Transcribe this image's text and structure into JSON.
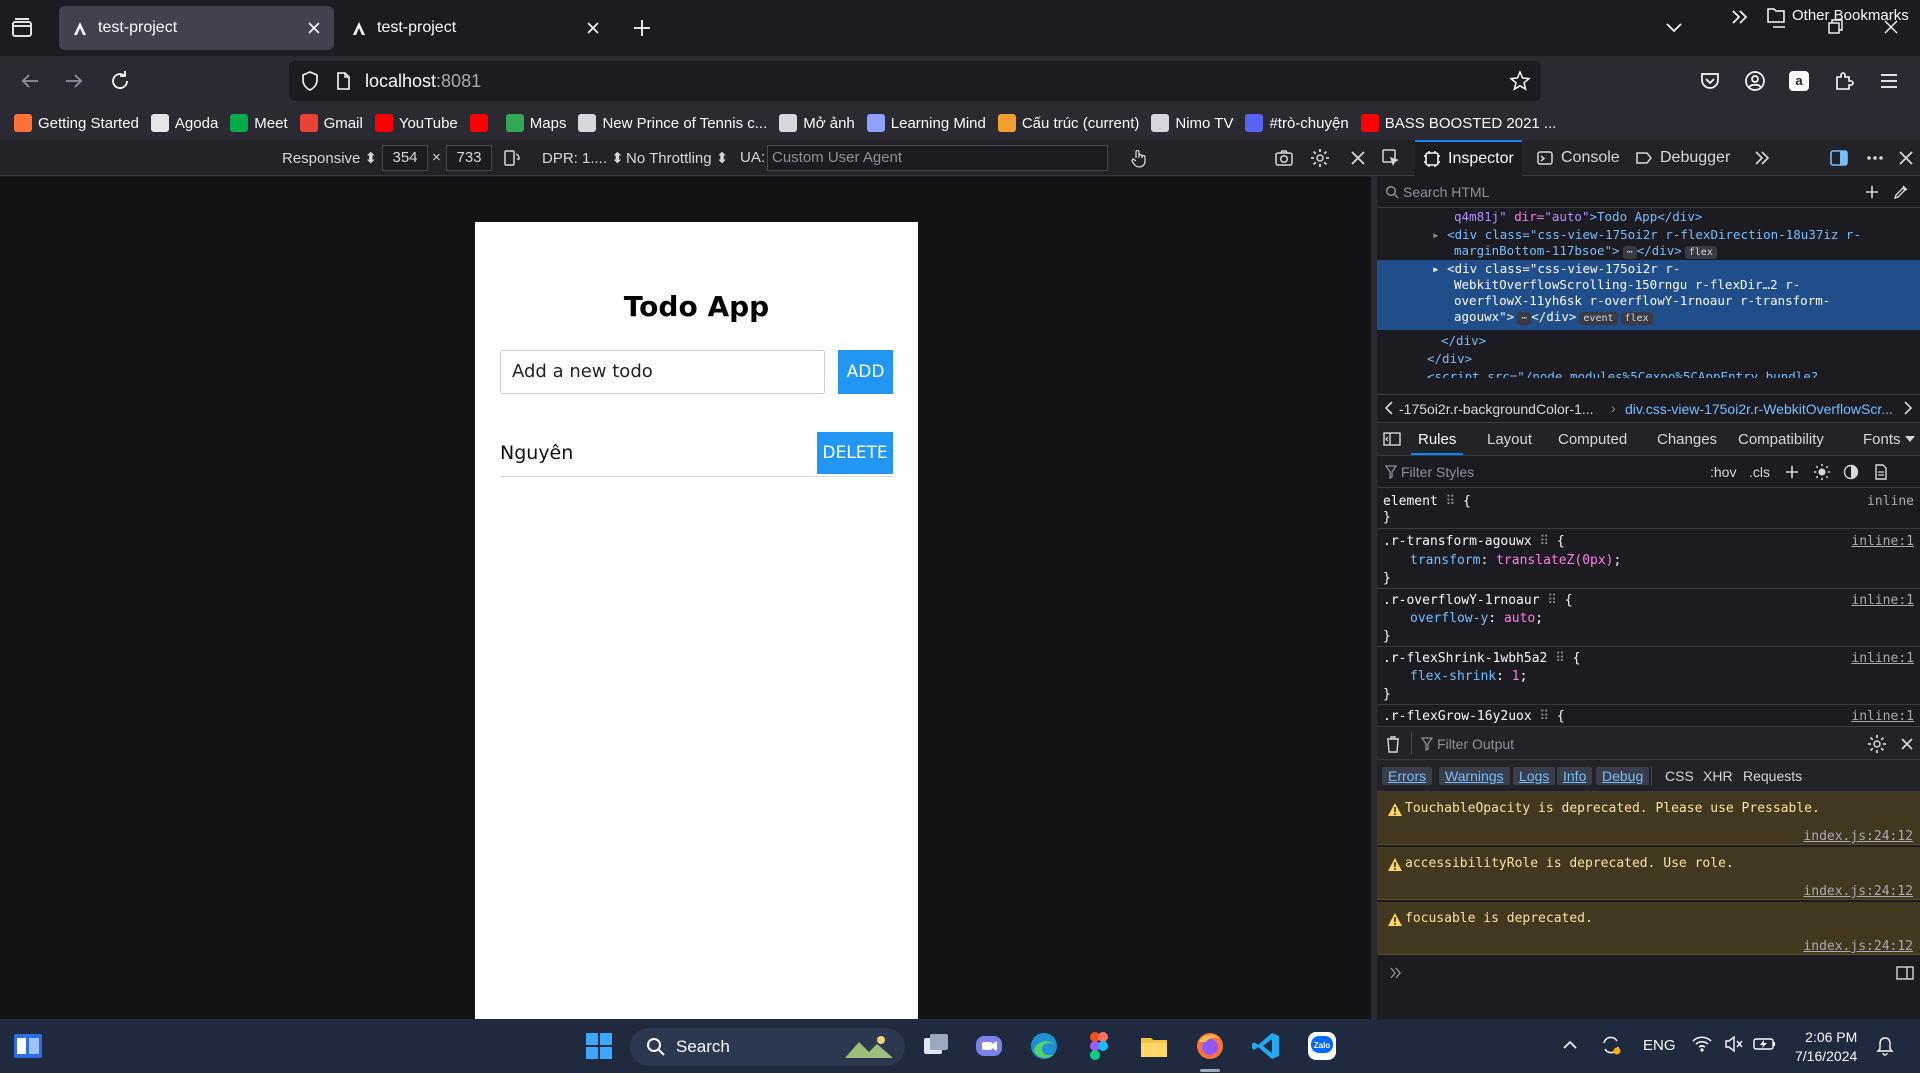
{
  "tabs": [
    {
      "title": "test-project",
      "active": true
    },
    {
      "title": "test-project",
      "active": false
    }
  ],
  "address": {
    "host": "localhost",
    "port": ":8081"
  },
  "bookmarks": [
    {
      "label": "Getting Started",
      "color": "#ff7139"
    },
    {
      "label": "Agoda",
      "color": "#e6e6e6"
    },
    {
      "label": "Meet",
      "color": "#00ac47"
    },
    {
      "label": "Gmail",
      "color": "#ea4335"
    },
    {
      "label": "YouTube",
      "color": "#ff0000"
    },
    {
      "label": "",
      "color": "#ff0000"
    },
    {
      "label": "Maps",
      "color": "#34a853"
    },
    {
      "label": "New Prince of Tennis c...",
      "color": "#d7d7db"
    },
    {
      "label": "Mở ảnh",
      "color": "#d7d7db"
    },
    {
      "label": "Learning Mind",
      "color": "#8da2ff"
    },
    {
      "label": "Cấu trúc (current)",
      "color": "#f0a030"
    },
    {
      "label": "Nimo TV",
      "color": "#d7d7db"
    },
    {
      "label": "#trò-chuyện",
      "color": "#5865f2"
    },
    {
      "label": "BASS BOOSTED 2021 ...",
      "color": "#ff0000"
    }
  ],
  "other_bookmarks": "Other Bookmarks",
  "rdm": {
    "responsive": "Responsive ⬍",
    "width": "354",
    "times": "×",
    "height": "733",
    "dpr": "DPR: 1.... ⬍",
    "throttling": "No Throttling ⬍",
    "ua_label": "UA:",
    "ua_placeholder": "Custom User Agent"
  },
  "app": {
    "title": "Todo App",
    "input_placeholder": "Add a new todo",
    "add_label": "ADD",
    "todos": [
      {
        "text": "Nguyên",
        "delete_label": "DELETE"
      }
    ]
  },
  "devtools": {
    "tabs": [
      "Inspector",
      "Console",
      "Debugger"
    ],
    "search_placeholder": "Search HTML",
    "markup": {
      "l1_attrval": "q4m81j\"",
      "l1_attr": "dir=",
      "l1_val": "\"auto\"",
      "l1_text": ">Todo App</div>",
      "l2a": "<div class=\"css-view-175oi2r r-flexDirection-18u37iz r-",
      "l2b": "marginBottom-117bsoe\">",
      "l2c": "</div>",
      "l3a": "<div class=\"css-view-175oi2r r-",
      "l3b": "WebkitOverflowScrolling-150rngu r-flexDir…2 r-",
      "l3c": "overflowX-11yh6sk r-overflowY-1rnoaur r-transform-",
      "l3d": "agouwx\">",
      "l3e": "</div>",
      "l4": "</div>",
      "l5": "</div>",
      "l6": "<script src=\"/node_modules%5Cexpo%5CAppEntry.bundle?",
      "badge_more": "⋯",
      "badge_flex": "flex",
      "badge_event": "event"
    },
    "breadcrumb_1": "-175oi2r.r-backgroundColor-1...",
    "breadcrumb_2": "div.css-view-175oi2r.r-WebkitOverflowScr...",
    "rules_tabs": [
      "Rules",
      "Layout",
      "Computed",
      "Changes",
      "Compatibility",
      "Fonts"
    ],
    "filter_styles": "Filter Styles",
    "hov": ":hov",
    "cls": ".cls",
    "rules": {
      "element_sel": "element",
      "element_src": "inline",
      "r1_sel": ".r-transform-agouwx",
      "r1_prop": "transform",
      "r1_val": "translateZ(0px)",
      "r2_sel": ".r-overflowY-1rnoaur",
      "r2_prop": "overflow-y",
      "r2_val": "auto",
      "r3_sel": ".r-flexShrink-1wbh5a2",
      "r3_prop": "flex-shrink",
      "r3_val": "1",
      "r4_sel": ".r-flexGrow-16y2uox",
      "src": "inline:1",
      "open_brace": "{",
      "close_brace": "}"
    },
    "console": {
      "filter_output": "Filter Output",
      "filters": [
        "Errors",
        "Warnings",
        "Logs",
        "Info",
        "Debug",
        "CSS",
        "XHR",
        "Requests"
      ],
      "messages": [
        {
          "text": "TouchableOpacity is deprecated. Please use Pressable.",
          "source": "index.js:24:12"
        },
        {
          "text": "accessibilityRole is deprecated. Use role.",
          "source": "index.js:24:12"
        },
        {
          "text": "focusable is deprecated.",
          "source": "index.js:24:12"
        }
      ]
    }
  },
  "taskbar": {
    "search_label": "Search",
    "language": "ENG",
    "time": "2:06 PM",
    "date": "7/16/2024"
  }
}
